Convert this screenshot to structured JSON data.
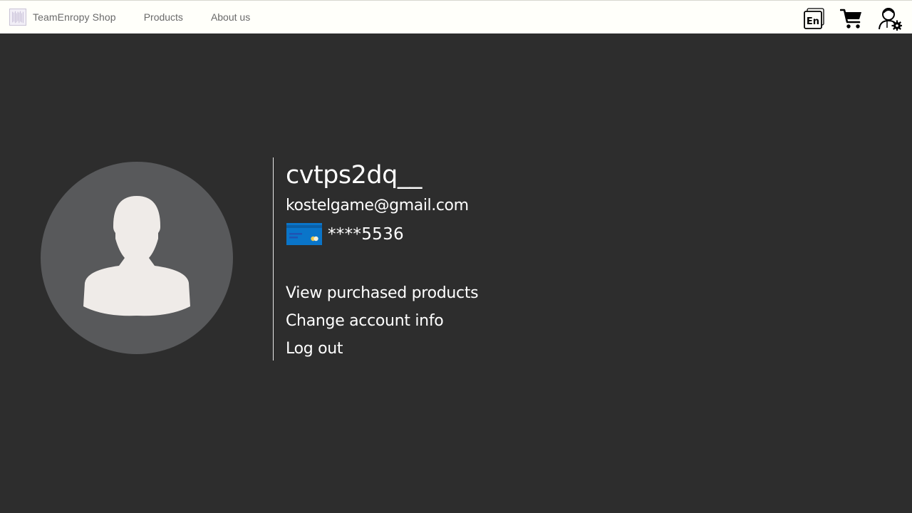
{
  "navbar": {
    "brand_name": "TeamEnropy Shop",
    "links": [
      "Products",
      "About us"
    ],
    "icons": [
      "language-en-icon",
      "cart-icon",
      "user-settings-icon"
    ],
    "language_code": "En"
  },
  "profile": {
    "username": "cvtps2dq__",
    "email": "kostelgame@gmail.com",
    "card_masked": "****5536",
    "avatar": "default-user-silhouette"
  },
  "actions": {
    "view_purchased": "View purchased products",
    "change_info": "Change account info",
    "logout": "Log out"
  },
  "colors": {
    "background": "#2d2d2d",
    "navbar": "#fffffa",
    "avatar_circle": "#58595b",
    "silhouette": "#efebe8",
    "card_blue": "#0a75c9"
  }
}
